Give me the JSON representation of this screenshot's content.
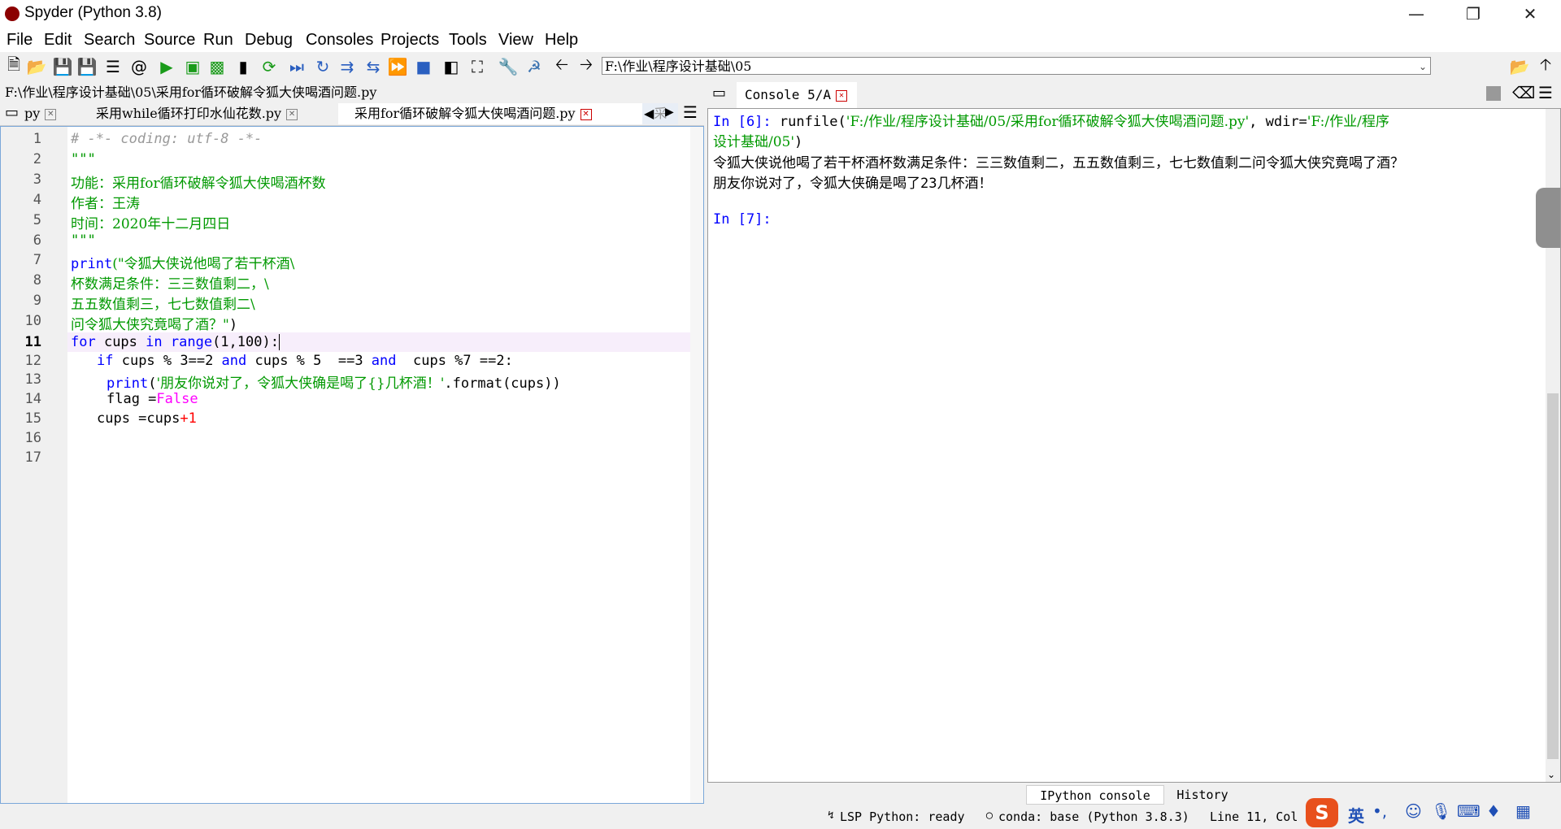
{
  "window": {
    "title": "Spyder (Python 3.8)"
  },
  "menu": [
    "File",
    "Edit",
    "Search",
    "Source",
    "Run",
    "Debug",
    "Consoles",
    "Projects",
    "Tools",
    "View",
    "Help"
  ],
  "toolbar": {
    "working_dir": "F:\\作业\\程序设计基础\\05"
  },
  "editor": {
    "file_path": "F:\\作业\\程序设计基础\\05\\采用for循环破解令狐大侠喝酒问题.py",
    "tabs": [
      {
        "label": "py"
      },
      {
        "label": "采用while循环打印水仙花数.py"
      },
      {
        "label": "采用for循环破解令狐大侠喝酒问题.py",
        "active": true
      },
      {
        "label": "采用"
      }
    ],
    "line_numbers": [
      "1",
      "2",
      "3",
      "4",
      "5",
      "6",
      "7",
      "8",
      "9",
      "10",
      "11",
      "12",
      "13",
      "14",
      "15",
      "16",
      "17"
    ],
    "current_line": "11",
    "code": {
      "l1": "# -*- coding: utf-8 -*-",
      "l2": "\"\"\"",
      "l3": "功能：采用for循环破解令狐大侠喝酒杯数",
      "l4": "作者：王涛",
      "l5": "时间：2020年十二月四日",
      "l6": "\"\"\"",
      "l7a": "print",
      "l7b": "(\"令狐大侠说他喝了若干杯酒\\",
      "l8": "杯数满足条件：三三数值剩二，\\",
      "l9": "五五数值剩三，七七数值剩二\\",
      "l10a": "问令狐大侠究竟喝了酒？\"",
      "l10b": ")",
      "l11a": "for",
      "l11b": " cups ",
      "l11c": "in",
      "l11d": " ",
      "l11e": "range",
      "l11f": "(1,100):",
      "l12a": "if",
      "l12b": " cups % 3==2 ",
      "l12c": "and",
      "l12d": " cups % 5  ==3 ",
      "l12e": "and",
      "l12f": "  cups %7 ==2:",
      "l13a": "print",
      "l13b": "(",
      "l13c": "'朋友你说对了，令狐大侠确是喝了{}几杯酒！'",
      "l13d": ".format(cups))",
      "l14a": "flag =",
      "l14b": "False",
      "l15a": "cups =cups",
      "l15b": "+1"
    }
  },
  "console": {
    "tab_label": "Console 5/A",
    "in6_prompt": "In [6]:",
    "in6_cmd": " runfile(",
    "in6_arg1": "'F:/作业/程序设计基础/05/采用for循环破解令狐大侠喝酒问题.py'",
    "in6_mid": ", wdir=",
    "in6_arg2a": "'F:/作业/程序",
    "in6_arg2b": "设计基础/05'",
    "in6_end": ")",
    "out1": "令狐大侠说他喝了若干杯酒杯数满足条件：三三数值剩二，五五数值剩三，七七数值剩二问令狐大侠究竟喝了酒？",
    "out2": "朋友你说对了，令狐大侠确是喝了23几杯酒！",
    "in7_prompt": "In [7]:",
    "bottom_tabs": [
      "IPython console",
      "History"
    ]
  },
  "status": {
    "lsp": "LSP Python: ready",
    "conda": "conda: base (Python 3.8.3)",
    "position": "Line 11, Col 2"
  }
}
